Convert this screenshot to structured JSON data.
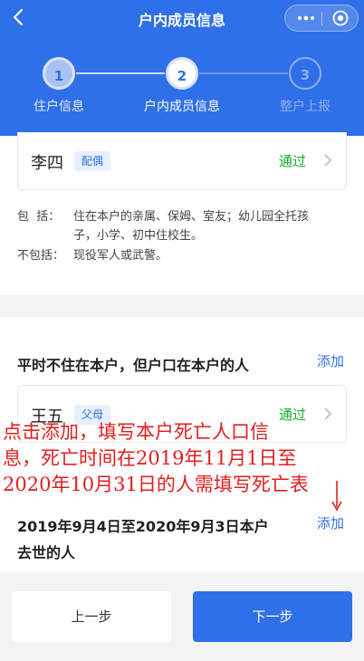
{
  "nav": {
    "title": "户内成员信息",
    "back_icon": "chevron-left-icon",
    "more_icon": "more-dots-icon",
    "close_icon": "target-icon"
  },
  "steps": [
    {
      "number": "1",
      "label": "住户信息",
      "state": "done"
    },
    {
      "number": "2",
      "label": "户内成员信息",
      "state": "active"
    },
    {
      "number": "3",
      "label": "整户上报",
      "state": "pending"
    }
  ],
  "resident_member": {
    "name": "李四",
    "relation": "配偶",
    "status": "通过"
  },
  "include_note": {
    "include_label": "包  括：",
    "include_line1": "住在本户的亲属、保姆、室友；幼儿园全托孩",
    "include_line2": "子，小学、初中住校生。",
    "exclude_label": "不包括：",
    "exclude_text": "现役军人或武警。"
  },
  "absent_section": {
    "title": "平时不住在本户，但户口在本户的人",
    "add": "添加",
    "member": {
      "name": "王五",
      "relation": "父母",
      "status": "通过"
    }
  },
  "deceased_section": {
    "title_line1": "2019年9月4日至2020年9月3日本户",
    "title_line2": "去世的人",
    "add": "添加"
  },
  "annotation": {
    "line1": "点击添加，填写本户死亡人口信",
    "line2": "息，死亡时间在2019年11月1日至",
    "line3": "2020年10月31日的人需填写死亡表"
  },
  "footer": {
    "prev": "上一步",
    "next": "下一步"
  },
  "colors": {
    "primary": "#2f6fe7",
    "pass": "#1aad2c",
    "annotation": "#e01f1f"
  }
}
